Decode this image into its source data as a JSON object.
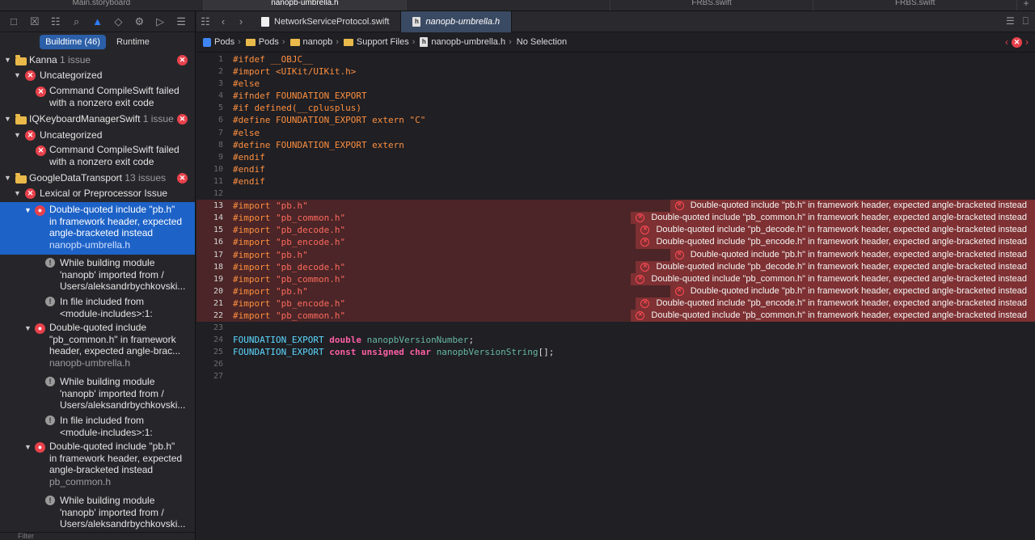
{
  "window_tabs": [
    "Main.storyboard",
    "nanopb-umbrella.h",
    "",
    "FRBS.swift",
    "FRBS.swift"
  ],
  "navigator": {
    "scopes": [
      "Buildtime (46)",
      "Runtime"
    ],
    "filter_placeholder": "Filter",
    "groups": [
      {
        "name": "Kanna",
        "count": "1 issue"
      },
      {
        "name": "IQKeyboardManagerSwift",
        "count": "1 issue"
      },
      {
        "name": "GoogleDataTransport",
        "count": "13 issues"
      }
    ],
    "categories": [
      "Uncategorized",
      "Uncategorized",
      "Lexical or Preprocessor Issue"
    ],
    "issues": [
      {
        "lines": [
          "Command CompileSwift failed",
          "with a nonzero exit code"
        ]
      },
      {
        "lines": [
          "Command CompileSwift failed",
          "with a nonzero exit code"
        ]
      },
      {
        "lines": [
          "Double-quoted include \"pb.h\"",
          "in framework header, expected",
          "angle-bracketed instead"
        ],
        "file": "nanopb-umbrella.h"
      },
      {
        "lines": [
          "While building module",
          "'nanopb' imported from /",
          "Users/aleksandrbychkovski..."
        ]
      },
      {
        "lines": [
          "In file included from",
          "<module-includes>:1:"
        ]
      },
      {
        "lines": [
          "Double-quoted include",
          "\"pb_common.h\" in framework",
          "header, expected angle-brac..."
        ],
        "file": "nanopb-umbrella.h"
      },
      {
        "lines": [
          "While building module",
          "'nanopb' imported from /",
          "Users/aleksandrbychkovski..."
        ]
      },
      {
        "lines": [
          "In file included from",
          "<module-includes>:1:"
        ]
      },
      {
        "lines": [
          "Double-quoted include \"pb.h\"",
          "in framework header, expected",
          "angle-bracketed instead"
        ],
        "file": "pb_common.h"
      },
      {
        "lines": [
          "While building module",
          "'nanopb' imported from /",
          "Users/aleksandrbychkovski..."
        ]
      }
    ]
  },
  "editor": {
    "tabs": [
      {
        "label": "NetworkServiceProtocol.swift",
        "icon": "swift-file-icon"
      },
      {
        "label": "nanopb-umbrella.h",
        "icon": "header-file-icon"
      }
    ],
    "breadcrumb": [
      "Pods",
      "Pods",
      "nanopb",
      "Support Files",
      "nanopb-umbrella.h",
      "No Selection"
    ],
    "code": [
      {
        "n": "1",
        "t": "#ifdef __OBJC__"
      },
      {
        "n": "2",
        "t": "#import <UIKit/UIKit.h>"
      },
      {
        "n": "3",
        "t": "#else"
      },
      {
        "n": "4",
        "t": "#ifndef FOUNDATION_EXPORT"
      },
      {
        "n": "5",
        "t": "#if defined(__cplusplus)"
      },
      {
        "n": "6",
        "t": "#define FOUNDATION_EXPORT extern \"C\""
      },
      {
        "n": "7",
        "t": "#else"
      },
      {
        "n": "8",
        "t": "#define FOUNDATION_EXPORT extern"
      },
      {
        "n": "9",
        "t": "#endif"
      },
      {
        "n": "10",
        "t": "#endif"
      },
      {
        "n": "11",
        "t": "#endif"
      },
      {
        "n": "12",
        "t": ""
      },
      {
        "n": "13",
        "t": "#import ",
        "s": "\"pb.h\"",
        "e": "Double-quoted include \"pb.h\" in framework header, expected angle-bracketed instead"
      },
      {
        "n": "14",
        "t": "#import ",
        "s": "\"pb_common.h\"",
        "e": "Double-quoted include \"pb_common.h\" in framework header, expected angle-bracketed instead"
      },
      {
        "n": "15",
        "t": "#import ",
        "s": "\"pb_decode.h\"",
        "e": "Double-quoted include \"pb_decode.h\" in framework header, expected angle-bracketed instead"
      },
      {
        "n": "16",
        "t": "#import ",
        "s": "\"pb_encode.h\"",
        "e": "Double-quoted include \"pb_encode.h\" in framework header, expected angle-bracketed instead"
      },
      {
        "n": "17",
        "t": "#import ",
        "s": "\"pb.h\"",
        "e": "Double-quoted include \"pb.h\" in framework header, expected angle-bracketed instead"
      },
      {
        "n": "18",
        "t": "#import ",
        "s": "\"pb_decode.h\"",
        "e": "Double-quoted include \"pb_decode.h\" in framework header, expected angle-bracketed instead"
      },
      {
        "n": "19",
        "t": "#import ",
        "s": "\"pb_common.h\"",
        "e": "Double-quoted include \"pb_common.h\" in framework header, expected angle-bracketed instead"
      },
      {
        "n": "20",
        "t": "#import ",
        "s": "\"pb.h\"",
        "e": "Double-quoted include \"pb.h\" in framework header, expected angle-bracketed instead"
      },
      {
        "n": "21",
        "t": "#import ",
        "s": "\"pb_encode.h\"",
        "e": "Double-quoted include \"pb_encode.h\" in framework header, expected angle-bracketed instead"
      },
      {
        "n": "22",
        "t": "#import ",
        "s": "\"pb_common.h\"",
        "e": "Double-quoted include \"pb_common.h\" in framework header, expected angle-bracketed instead"
      },
      {
        "n": "23",
        "t": ""
      },
      {
        "n": "24",
        "parts": [
          [
            "mac",
            "FOUNDATION_EXPORT"
          ],
          [
            "pl",
            " "
          ],
          [
            "kw",
            "double"
          ],
          [
            "pl",
            " "
          ],
          [
            "id",
            "nanopbVersionNumber"
          ],
          [
            "pl",
            ";"
          ]
        ]
      },
      {
        "n": "25",
        "parts": [
          [
            "mac",
            "FOUNDATION_EXPORT"
          ],
          [
            "pl",
            " "
          ],
          [
            "kw",
            "const unsigned char"
          ],
          [
            "pl",
            " "
          ],
          [
            "id",
            "nanopbVersionString"
          ],
          [
            "pl",
            "[];"
          ]
        ]
      },
      {
        "n": "26",
        "t": ""
      },
      {
        "n": "27",
        "t": ""
      }
    ]
  },
  "colors": {
    "accent": "#1d62c7",
    "error": "#e8414c",
    "error_line_bg": "#4b2527",
    "error_message_bg": "#7e3032",
    "preprocessor": "#fd8f3f",
    "string": "#fc6a5d"
  }
}
